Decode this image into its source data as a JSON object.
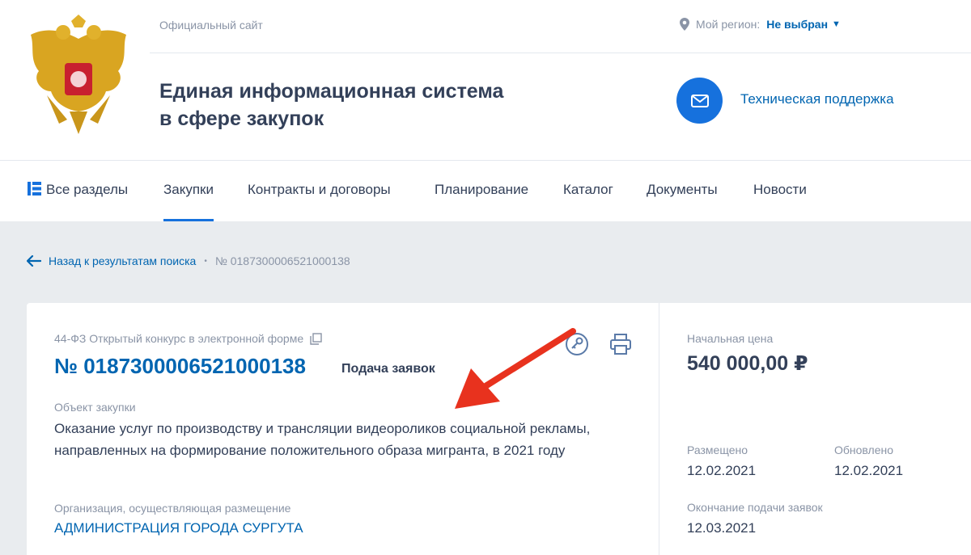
{
  "header": {
    "official_label": "Официальный сайт",
    "region_label": "Мой регион:",
    "region_value": "Не выбран",
    "title_line1": "Единая информационная система",
    "title_line2": "в сфере закупок",
    "support_label": "Техническая поддержка",
    "icons": {
      "emblem": "coat-of-arms",
      "region": "map-pin-icon",
      "support": "mail-icon"
    }
  },
  "nav": {
    "items": [
      {
        "label": "Все разделы"
      },
      {
        "label": "Закупки",
        "active": true
      },
      {
        "label": "Контракты и договоры"
      },
      {
        "label": "Планирование"
      },
      {
        "label": "Каталог"
      },
      {
        "label": "Документы"
      },
      {
        "label": "Новости"
      }
    ]
  },
  "breadcrumb": {
    "back_label": "Назад к результатам поиска",
    "current": "№ 0187300006521000138"
  },
  "procurement": {
    "type": "44-ФЗ Открытый конкурс в электронной форме",
    "number": "№ 0187300006521000138",
    "status": "Подача заявок",
    "object_label": "Объект закупки",
    "object_text": "Оказание услуг по производству и трансляции видеороликов социальной рекламы, направленных на формирование положительного образа мигранта, в 2021 году",
    "org_label": "Организация, осуществляющая размещение",
    "org_name": "АДМИНИСТРАЦИЯ ГОРОДА СУРГУТА"
  },
  "sidebar": {
    "price_label": "Начальная цена",
    "price_value": "540 000,00 ₽",
    "posted_label": "Размещено",
    "posted_value": "12.02.2021",
    "updated_label": "Обновлено",
    "updated_value": "12.02.2021",
    "deadline_label": "Окончание подачи заявок",
    "deadline_value": "12.03.2021"
  },
  "colors": {
    "accent": "#1671dd",
    "link": "#0065b1",
    "text": "#334059",
    "muted": "#8a94a6",
    "annotation_arrow": "#e8321e"
  }
}
